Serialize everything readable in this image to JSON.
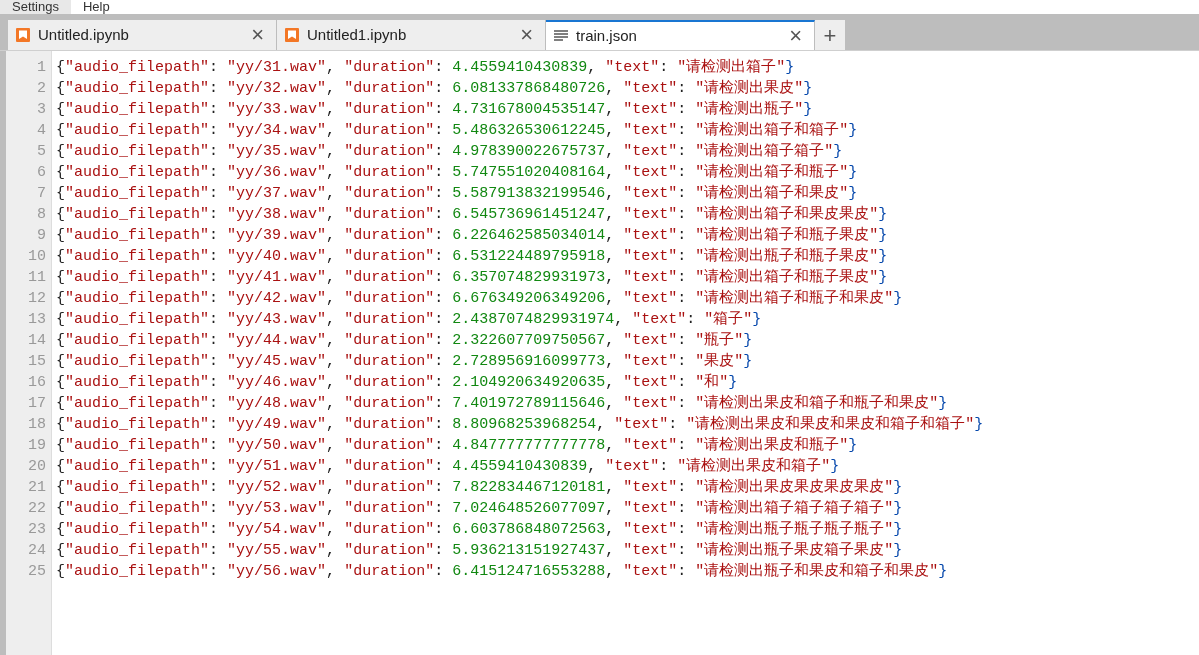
{
  "menu_bar": [
    "Settings",
    "Help"
  ],
  "tabs": [
    {
      "label": "Untitled.ipynb",
      "kind": "notebook",
      "selected": false,
      "close": "×"
    },
    {
      "label": "Untitled1.ipynb",
      "kind": "notebook",
      "selected": false,
      "close": "×"
    },
    {
      "label": "train.json",
      "kind": "text",
      "selected": true,
      "close": "×"
    }
  ],
  "new_tab": "+",
  "editor": {
    "lines": [
      {
        "number": "1",
        "code": "{\"audio_filepath\": \"yy/31.wav\", \"duration\": 4.4559410430839, \"text\": \"请检测出箱子\"}"
      },
      {
        "number": "2",
        "code": "{\"audio_filepath\": \"yy/32.wav\", \"duration\": 6.081337868480726, \"text\": \"请检测出果皮\"}"
      },
      {
        "number": "3",
        "code": "{\"audio_filepath\": \"yy/33.wav\", \"duration\": 4.731678004535147, \"text\": \"请检测出瓶子\"}"
      },
      {
        "number": "4",
        "code": "{\"audio_filepath\": \"yy/34.wav\", \"duration\": 5.486326530612245, \"text\": \"请检测出箱子和箱子\"}"
      },
      {
        "number": "5",
        "code": "{\"audio_filepath\": \"yy/35.wav\", \"duration\": 4.978390022675737, \"text\": \"请检测出箱子箱子\"}"
      },
      {
        "number": "6",
        "code": "{\"audio_filepath\": \"yy/36.wav\", \"duration\": 5.747551020408164, \"text\": \"请检测出箱子和瓶子\"}"
      },
      {
        "number": "7",
        "code": "{\"audio_filepath\": \"yy/37.wav\", \"duration\": 5.587913832199546, \"text\": \"请检测出箱子和果皮\"}"
      },
      {
        "number": "8",
        "code": "{\"audio_filepath\": \"yy/38.wav\", \"duration\": 6.545736961451247, \"text\": \"请检测出箱子和果皮果皮\"}"
      },
      {
        "number": "9",
        "code": "{\"audio_filepath\": \"yy/39.wav\", \"duration\": 6.226462585034014, \"text\": \"请检测出箱子和瓶子果皮\"}"
      },
      {
        "number": "10",
        "code": "{\"audio_filepath\": \"yy/40.wav\", \"duration\": 6.531224489795918, \"text\": \"请检测出瓶子和瓶子果皮\"}"
      },
      {
        "number": "11",
        "code": "{\"audio_filepath\": \"yy/41.wav\", \"duration\": 6.357074829931973, \"text\": \"请检测出箱子和瓶子果皮\"}"
      },
      {
        "number": "12",
        "code": "{\"audio_filepath\": \"yy/42.wav\", \"duration\": 6.676349206349206, \"text\": \"请检测出箱子和瓶子和果皮\"}"
      },
      {
        "number": "13",
        "code": "{\"audio_filepath\": \"yy/43.wav\", \"duration\": 2.4387074829931974, \"text\": \"箱子\"}"
      },
      {
        "number": "14",
        "code": "{\"audio_filepath\": \"yy/44.wav\", \"duration\": 2.322607709750567, \"text\": \"瓶子\"}"
      },
      {
        "number": "15",
        "code": "{\"audio_filepath\": \"yy/45.wav\", \"duration\": 2.728956916099773, \"text\": \"果皮\"}"
      },
      {
        "number": "16",
        "code": "{\"audio_filepath\": \"yy/46.wav\", \"duration\": 2.104920634920635, \"text\": \"和\"}"
      },
      {
        "number": "17",
        "code": "{\"audio_filepath\": \"yy/48.wav\", \"duration\": 7.401972789115646, \"text\": \"请检测出果皮和箱子和瓶子和果皮\"}"
      },
      {
        "number": "18",
        "code": "{\"audio_filepath\": \"yy/49.wav\", \"duration\": 8.80968253968254, \"text\": \"请检测出果皮和果皮和果皮和箱子和箱子\"}"
      },
      {
        "number": "19",
        "code": "{\"audio_filepath\": \"yy/50.wav\", \"duration\": 4.847777777777778, \"text\": \"请检测出果皮和瓶子\"}"
      },
      {
        "number": "20",
        "code": "{\"audio_filepath\": \"yy/51.wav\", \"duration\": 4.4559410430839, \"text\": \"请检测出果皮和箱子\"}"
      },
      {
        "number": "21",
        "code": "{\"audio_filepath\": \"yy/52.wav\", \"duration\": 7.822834467120181, \"text\": \"请检测出果皮果皮果皮果皮\"}"
      },
      {
        "number": "22",
        "code": "{\"audio_filepath\": \"yy/53.wav\", \"duration\": 7.024648526077097, \"text\": \"请检测出箱子箱子箱子箱子\"}"
      },
      {
        "number": "23",
        "code": "{\"audio_filepath\": \"yy/54.wav\", \"duration\": 6.603786848072563, \"text\": \"请检测出瓶子瓶子瓶子瓶子\"}"
      },
      {
        "number": "24",
        "code": "{\"audio_filepath\": \"yy/55.wav\", \"duration\": 5.936213151927437, \"text\": \"请检测出瓶子果皮箱子果皮\"}"
      },
      {
        "number": "25",
        "code": "{\"audio_filepath\": \"yy/56.wav\", \"duration\": 6.415124716553288, \"text\": \"请检测出瓶子和果皮和箱子和果皮\"}"
      }
    ]
  }
}
